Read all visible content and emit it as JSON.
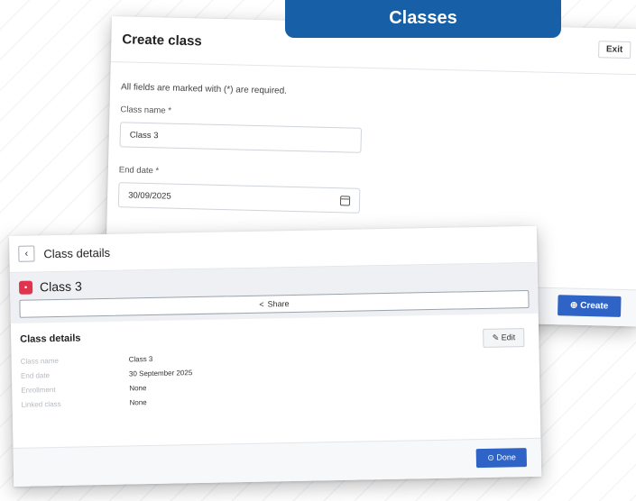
{
  "create_dialog": {
    "title": "Create class",
    "exit_label": "Exit",
    "required_note": "All fields are marked with (*) are required.",
    "class_name_label": "Class name *",
    "class_name_value": "Class 3",
    "end_date_label": "End date *",
    "end_date_value": "30/09/2025",
    "create_label": "Create"
  },
  "details_view": {
    "title": "Class details",
    "class_name": "Class 3",
    "share_label": "Share",
    "panel_title": "Class details",
    "edit_label": "Edit",
    "rows": [
      {
        "key": "Class name",
        "value": "Class 3"
      },
      {
        "key": "End date",
        "value": "30 September 2025"
      },
      {
        "key": "Enrollment",
        "value": "None"
      },
      {
        "key": "Linked class",
        "value": "None"
      }
    ],
    "done_label": "Done"
  },
  "banner": {
    "text": "Classes"
  },
  "colors": {
    "accent": "#2f63c6",
    "banner": "#1760a8",
    "class_badge": "#e0344e"
  }
}
